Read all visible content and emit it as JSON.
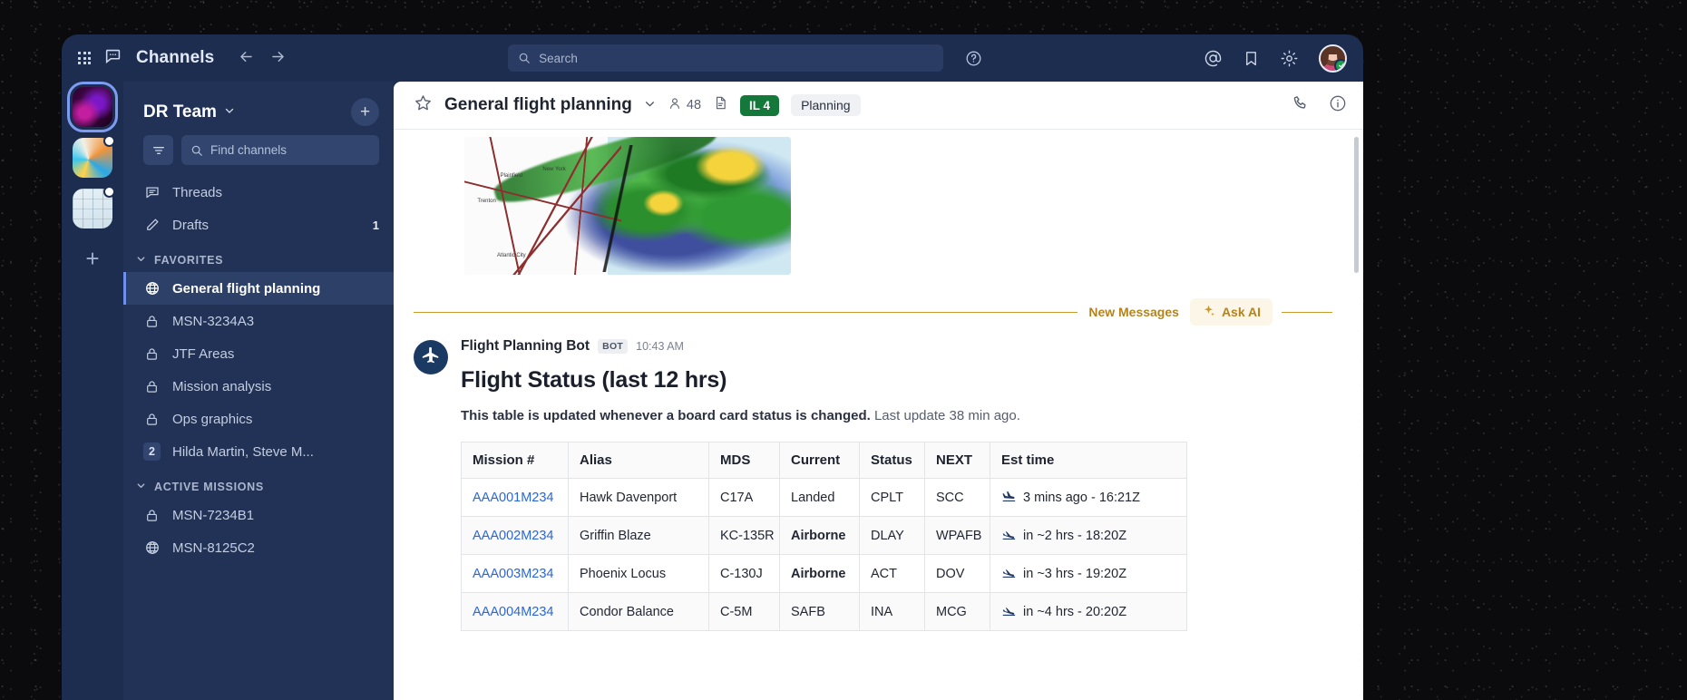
{
  "topbar": {
    "app_title": "Channels",
    "back_icon": "arrow-left-icon",
    "forward_icon": "arrow-right-icon",
    "grid_icon": "app-grid-icon",
    "channels_icon": "chat-bubble-icon",
    "search_placeholder": "Search",
    "help_icon": "help-circle-icon",
    "mention_icon": "at-mention-icon",
    "bookmark_icon": "bookmark-icon",
    "settings_icon": "gear-icon",
    "avatar_label": "user-avatar",
    "presence": "online"
  },
  "rail": {
    "workspaces": [
      {
        "name": "workspace-1",
        "selected": true,
        "unread": false
      },
      {
        "name": "workspace-2",
        "selected": false,
        "unread": true
      },
      {
        "name": "workspace-3",
        "selected": false,
        "unread": true
      }
    ],
    "add_label": "+"
  },
  "sidebar": {
    "team_name": "DR Team",
    "team_chevron": "⌄",
    "add_button": "+",
    "filter_icon": "filter-icon",
    "find_placeholder": "Find channels",
    "quick": [
      {
        "label": "Threads",
        "icon": "threads-icon",
        "badge": ""
      },
      {
        "label": "Drafts",
        "icon": "pencil-icon",
        "badge": "1"
      }
    ],
    "sections": [
      {
        "title": "FAVORITES",
        "items": [
          {
            "label": "General flight planning",
            "icon": "globe-icon",
            "active": true,
            "badge": ""
          },
          {
            "label": "MSN-3234A3",
            "icon": "lock-icon",
            "active": false,
            "badge": ""
          },
          {
            "label": "JTF Areas",
            "icon": "lock-icon",
            "active": false,
            "badge": ""
          },
          {
            "label": "Mission analysis",
            "icon": "lock-icon",
            "active": false,
            "badge": ""
          },
          {
            "label": "Ops graphics",
            "icon": "lock-icon",
            "active": false,
            "badge": ""
          },
          {
            "label": "Hilda Martin, Steve M...",
            "icon": "dm-count",
            "active": false,
            "badge": "2"
          }
        ]
      },
      {
        "title": "ACTIVE MISSIONS",
        "items": [
          {
            "label": "MSN-7234B1",
            "icon": "lock-icon",
            "active": false,
            "badge": ""
          },
          {
            "label": "MSN-8125C2",
            "icon": "globe-icon",
            "active": false,
            "badge": ""
          }
        ]
      }
    ]
  },
  "channel_header": {
    "star_icon": "star-icon",
    "title": "General flight planning",
    "chevron": "⌄",
    "member_icon": "person-icon",
    "member_count": "48",
    "doc_icon": "document-icon",
    "il_badge": "IL 4",
    "il_badge_color": "#13783a",
    "plan_badge": "Planning",
    "call_icon": "phone-icon",
    "info_icon": "info-circle-icon"
  },
  "divider": {
    "new_messages_label": "New Messages",
    "ask_ai_label": "Ask AI",
    "ask_ai_icon": "sparkle-icon",
    "accent_color": "#c79a29"
  },
  "message": {
    "avatar_icon": "airplane-icon",
    "author": "Flight Planning Bot",
    "bot_tag": "BOT",
    "time": "10:43 AM",
    "heading": "Flight Status (last 12 hrs)",
    "subtitle_bold": "This table is updated whenever a board card status is changed.",
    "subtitle_rest": " Last update 38 min ago.",
    "attachment_alt": "weather-radar-map"
  },
  "table": {
    "columns": [
      "Mission #",
      "Alias",
      "MDS",
      "Current",
      "Status",
      "NEXT",
      "Est time"
    ],
    "rows": [
      {
        "mission": "AAA001M234",
        "alias": "Hawk Davenport",
        "mds": "C17A",
        "current": "Landed",
        "current_color": "#1f8f4d",
        "status": "CPLT",
        "status_color": "#222733",
        "next": "SCC",
        "est_icon": "plane-landing-icon",
        "est": "3 mins ago - 16:21Z"
      },
      {
        "mission": "AAA002M234",
        "alias": "Griffin Blaze",
        "mds": "KC-135R",
        "current": "Airborne",
        "current_color": "#1f5fe0",
        "status": "DLAY",
        "status_color": "#e03030",
        "next": "WPAFB",
        "est_icon": "plane-takeoff-icon",
        "est": "in ~2 hrs - 18:20Z"
      },
      {
        "mission": "AAA003M234",
        "alias": "Phoenix Locus",
        "mds": "C-130J",
        "current": "Airborne",
        "current_color": "#1f5fe0",
        "status": "ACT",
        "status_color": "#1f8f4d",
        "next": "DOV",
        "est_icon": "plane-takeoff-icon",
        "est": "in ~3 hrs - 19:20Z"
      },
      {
        "mission": "AAA004M234",
        "alias": "Condor Balance",
        "mds": "C-5M",
        "current": "SAFB",
        "current_color": "#222733",
        "status": "INA",
        "status_color": "#222733",
        "next": "MCG",
        "est_icon": "plane-takeoff-icon",
        "est": "in ~4 hrs - 20:20Z"
      }
    ]
  },
  "radar_map": {
    "labels": [
      "Plainfield",
      "New York",
      "Trenton",
      "Atlantic City"
    ]
  }
}
